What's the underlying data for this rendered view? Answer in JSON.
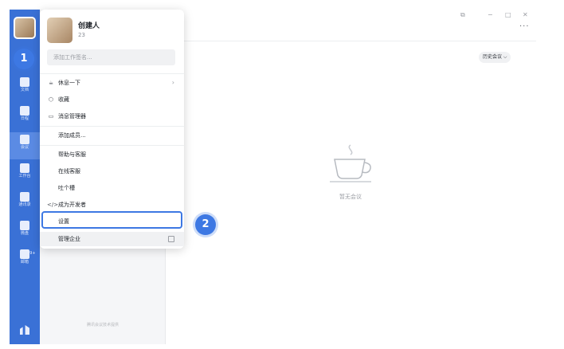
{
  "rail": {
    "items": [
      {
        "name": "docs",
        "label": "文档"
      },
      {
        "name": "calendar",
        "label": "日程"
      },
      {
        "name": "meeting",
        "label": "会议"
      },
      {
        "name": "workbench",
        "label": "工作台"
      },
      {
        "name": "contacts",
        "label": "通讯录"
      },
      {
        "name": "drive",
        "label": "微盘"
      },
      {
        "name": "mail",
        "label": "邮箱"
      }
    ],
    "mail_badge": "99+"
  },
  "popup": {
    "user_name": "创建人",
    "user_sub": "23",
    "status_placeholder": "添加工作签名...",
    "menu": [
      {
        "icon": "☕",
        "label": "休息一下",
        "arrow": "›"
      },
      {
        "icon": "⬡",
        "label": "收藏"
      },
      {
        "icon": "▭",
        "label": "消息管理器"
      },
      {
        "label": "添加成员..."
      },
      {
        "label": "帮助与客服"
      },
      {
        "label": "在线客服"
      },
      {
        "label": "吐个槽"
      },
      {
        "icon": "</>",
        "label": "成为开发者"
      },
      {
        "label": "设置"
      },
      {
        "label": "管理企业"
      }
    ]
  },
  "main": {
    "history_button": "历史会议 ⌵",
    "empty_text": "暂无会议",
    "footer_text": "腾讯会议技术提供",
    "more": "···"
  },
  "window_controls": {
    "pin": "⧉",
    "minimize": "−",
    "maximize": "□",
    "close": "✕"
  },
  "callouts": {
    "one": "1",
    "two": "2"
  },
  "colors": {
    "rail": "#3a71d6",
    "accent": "#3d78e3"
  }
}
